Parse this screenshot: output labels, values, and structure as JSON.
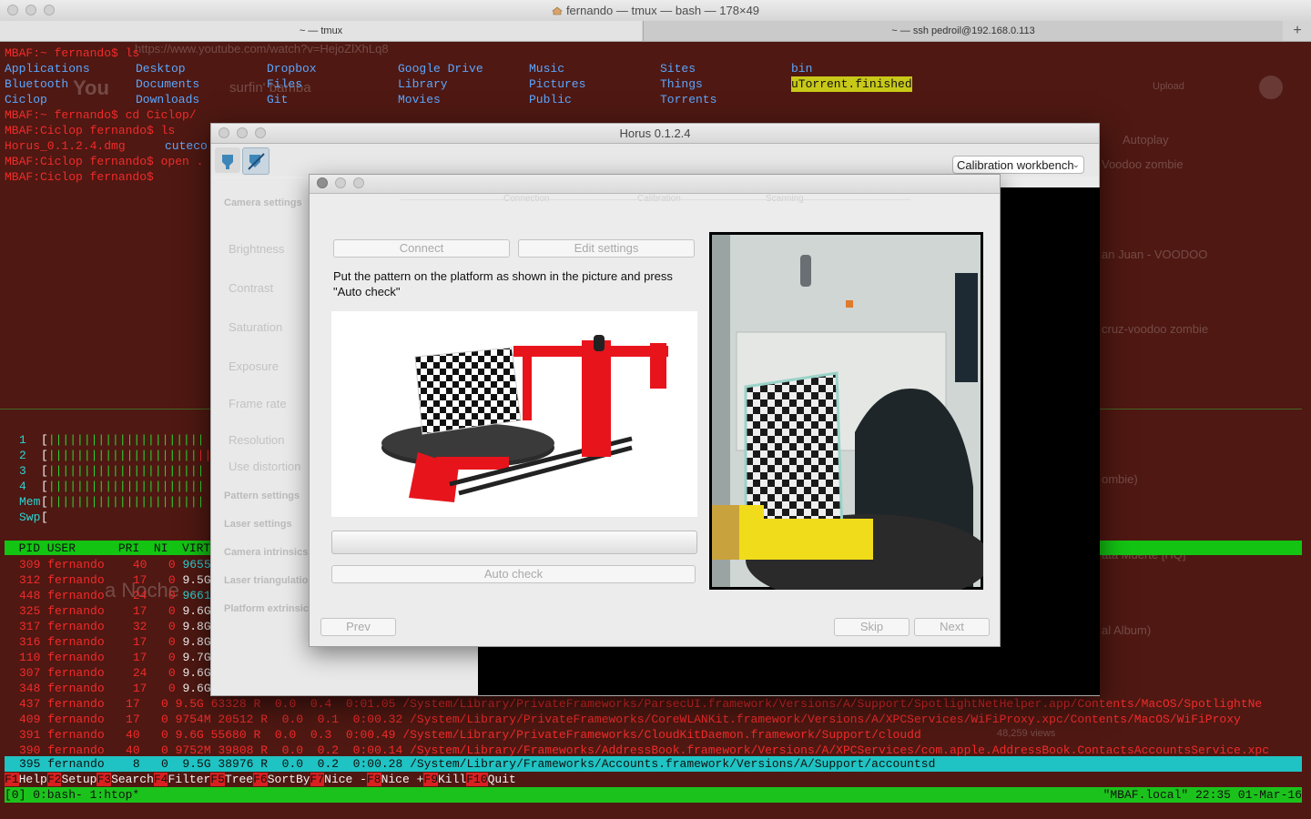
{
  "terminal": {
    "title": "fernando — tmux — bash — 178×49",
    "tabs": [
      "~ — tmux",
      "~ — ssh pedroil@192.168.0.113"
    ],
    "add_tab": "+",
    "prompt_lines": [
      "MBAF:~ fernando$ ls",
      "MBAF:~ fernando$ cd Ciclop/",
      "MBAF:Ciclop fernando$ ls",
      "MBAF:Ciclop fernando$ open .",
      "MBAF:Ciclop fernando$"
    ],
    "ls_rows": [
      [
        "Applications",
        "Desktop",
        "Dropbox",
        "Google Drive",
        "Music",
        "Sites",
        "bin"
      ],
      [
        "Bluetooth",
        "Documents",
        "Files",
        "Library",
        "Pictures",
        "Things",
        "uTorrent.finished"
      ],
      [
        "Ciclop",
        "Downloads",
        "Git",
        "Movies",
        "Public",
        "Torrents",
        ""
      ]
    ],
    "ciclop_ls": [
      "Horus_0.1.2.4.dmg",
      "cuteco"
    ],
    "cpu_rows": [
      "1",
      "2",
      "3",
      "4",
      "Mem",
      "Swp"
    ],
    "htop_header": "  PID USER      PRI  NI  VIRT",
    "processes": [
      {
        "pid": "309",
        "user": "fernando",
        "pri": "40",
        "ni": "0",
        "virt": "9655M"
      },
      {
        "pid": "312",
        "user": "fernando",
        "pri": "17",
        "ni": "0",
        "virt": "9.5G"
      },
      {
        "pid": "448",
        "user": "fernando",
        "pri": "24",
        "ni": "0",
        "virt": "9661M"
      },
      {
        "pid": "325",
        "user": "fernando",
        "pri": "17",
        "ni": "0",
        "virt": "9.6G"
      },
      {
        "pid": "317",
        "user": "fernando",
        "pri": "32",
        "ni": "0",
        "virt": "9.8G"
      },
      {
        "pid": "316",
        "user": "fernando",
        "pri": "17",
        "ni": "0",
        "virt": "9.8G"
      },
      {
        "pid": "110",
        "user": "fernando",
        "pri": "17",
        "ni": "0",
        "virt": "9.7G"
      },
      {
        "pid": "307",
        "user": "fernando",
        "pri": "24",
        "ni": "0",
        "virt": "9.6G"
      },
      {
        "pid": "348",
        "user": "fernando",
        "pri": "17",
        "ni": "0",
        "virt": "9.6G"
      }
    ],
    "process_full": [
      "437 fernando   17   0 9.5G 63328 R  0.0  0.4  0:01.05 /System/Library/PrivateFrameworks/ParsecUI.framework/Versions/A/Support/SpotlightNetHelper.app/Contents/MacOS/SpotlightNe",
      "409 fernando   17   0 9754M 20512 R  0.0  0.1  0:00.32 /System/Library/PrivateFrameworks/CoreWLANKit.framework/Versions/A/XPCServices/WiFiProxy.xpc/Contents/MacOS/WiFiProxy",
      "391 fernando   40   0 9.6G 55680 R  0.0  0.3  0:00.49 /System/Library/PrivateFrameworks/CloudKitDaemon.framework/Support/cloudd",
      "390 fernando   40   0 9752M 39808 R  0.0  0.2  0:00.14 /System/Library/Frameworks/AddressBook.framework/Versions/A/XPCServices/com.apple.AddressBook.ContactsAccountsService.xpc"
    ],
    "selected_process": "395 fernando    8   0  9.5G 38976 R  0.0  0.2  0:00.28 /System/Library/Frameworks/Accounts.framework/Versions/A/Support/accountsd",
    "fkeys": [
      {
        "key": "F1",
        "label": "Help"
      },
      {
        "key": "F2",
        "label": "Setup"
      },
      {
        "key": "F3",
        "label": "Search"
      },
      {
        "key": "F4",
        "label": "Filter"
      },
      {
        "key": "F5",
        "label": "Tree"
      },
      {
        "key": "F6",
        "label": "SortBy"
      },
      {
        "key": "F7",
        "label": "Nice -"
      },
      {
        "key": "F8",
        "label": "Nice +"
      },
      {
        "key": "F9",
        "label": "Kill"
      },
      {
        "key": "F10",
        "label": "Quit"
      }
    ],
    "tmux_left": "[0] 0:bash- 1:htop*",
    "tmux_right": "\"MBAF.local\" 22:35 01-Mar-16"
  },
  "background_ghost": {
    "url": "https://www.youtube.com/watch?v=HejoZlXhLq8",
    "search": "surfin' bamba",
    "upload": "Upload",
    "autoplay": "Autoplay",
    "items": [
      "Voodoo zombie",
      "an Juan - VOODOO",
      "cruz-voodoo zombie",
      "ombie)",
      "ata Muerte [HQ]",
      "al Album)",
      "48,259 views"
    ],
    "left_text": "a Noche"
  },
  "horus": {
    "title": "Horus 0.1.2.4",
    "workbench": "Calibration workbench",
    "sidebar_sections": [
      "Camera settings",
      "Pattern settings",
      "Laser settings",
      "Camera intrinsics",
      "Laser triangulation",
      "Platform extrinsics"
    ],
    "camera_labels": [
      "Brightness",
      "Contrast",
      "Saturation",
      "Exposure",
      "Frame rate",
      "Resolution",
      "Use distortion"
    ]
  },
  "wizard": {
    "steps": [
      "Connection",
      "Calibration",
      "Scanning"
    ],
    "connect_button": "Connect",
    "edit_settings_button": "Edit settings",
    "instruction": "Put the pattern on the platform as shown in the picture and press \"Auto check\"",
    "progress": 0,
    "auto_check_button": "Auto check",
    "prev_button": "Prev",
    "skip_button": "Skip",
    "next_button": "Next"
  },
  "colors": {
    "prompt": "#f12b2b",
    "dir": "#5aa7ff",
    "htop_green": "#13c413",
    "htop_cyan": "#20c3c3",
    "scanner_red": "#e8141c"
  }
}
